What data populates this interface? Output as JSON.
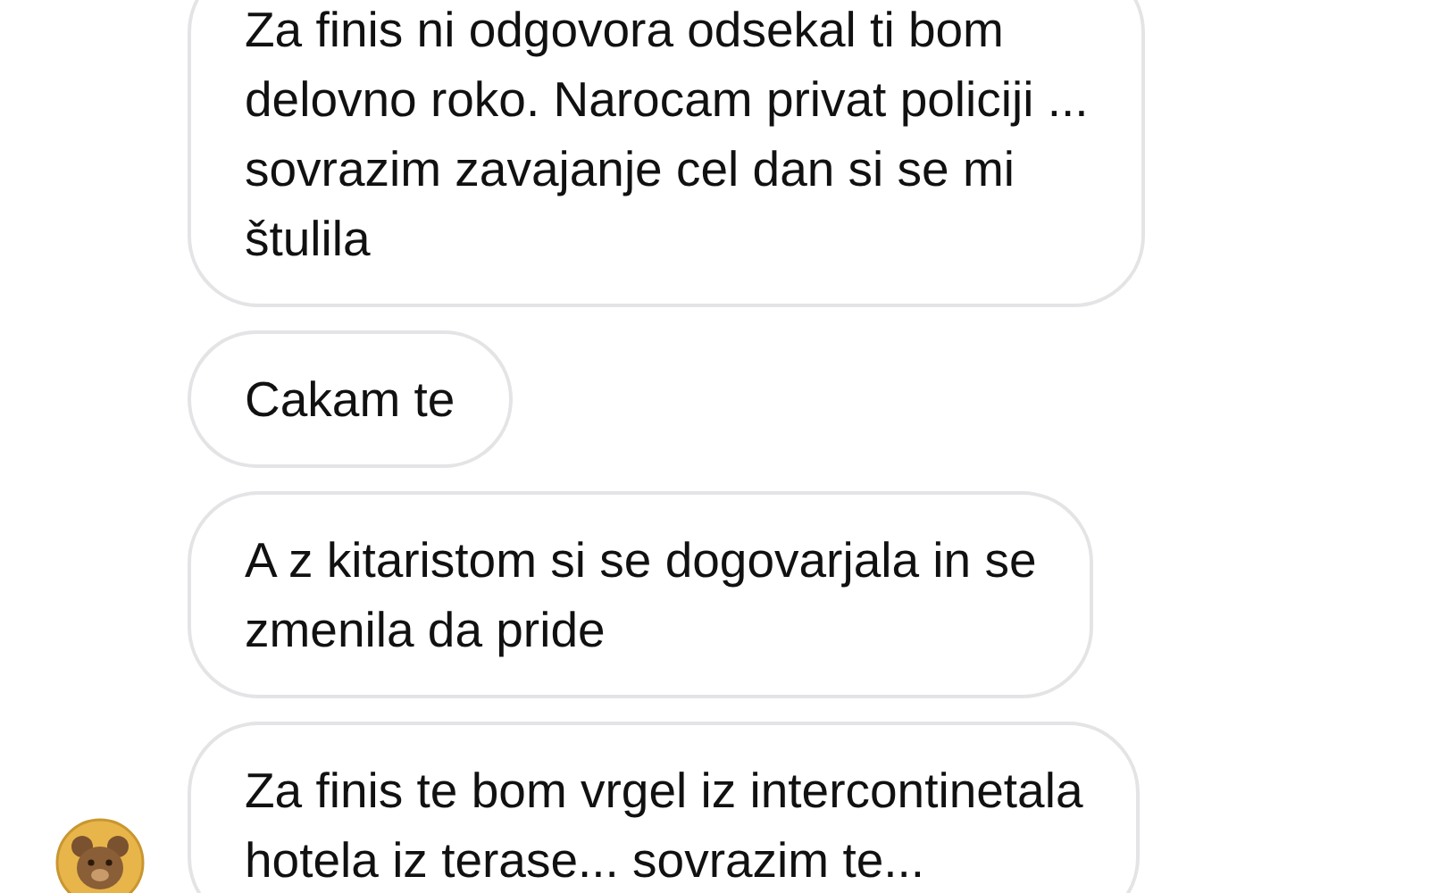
{
  "messages": [
    {
      "text": "Za finis ni odgovora odsekal ti bom\ndelovno roko. Narocam privat policiji ...\nsovrazim zavajanje cel dan si se mi\nštulila",
      "avatar": false
    },
    {
      "text": "Cakam te",
      "avatar": false
    },
    {
      "text": "A z kitaristom si se dogovarjala in se\nzmenila da pride",
      "avatar": false
    },
    {
      "text": "Za finis te bom vrgel iz intercontinetala\nhotela iz terase... sovrazim te...",
      "avatar": true
    }
  ]
}
